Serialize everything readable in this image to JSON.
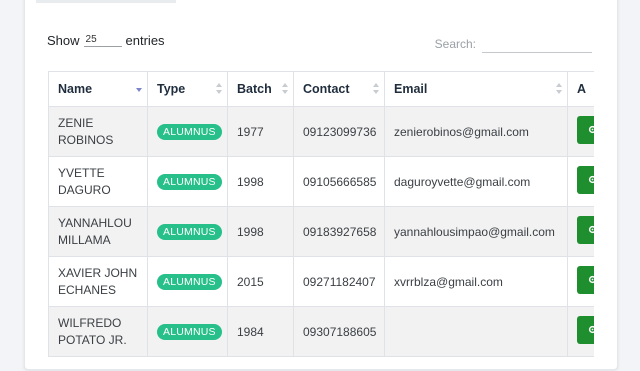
{
  "length": {
    "prefix": "Show",
    "value": "25",
    "suffix": "entries"
  },
  "search": {
    "label": "Search:",
    "value": ""
  },
  "table": {
    "columns": [
      "Name",
      "Type",
      "Batch",
      "Contact",
      "Email",
      "A"
    ],
    "rows": [
      {
        "name_line1": "ZENIE",
        "name_line2": "ROBINOS",
        "type": "ALUMNUS",
        "batch": "1977",
        "contact": "09123099736",
        "email": "zenierobinos@gmail.com"
      },
      {
        "name_line1": "YVETTE",
        "name_line2": "DAGURO",
        "type": "ALUMNUS",
        "batch": "1998",
        "contact": "09105666585",
        "email": "daguroyvette@gmail.com"
      },
      {
        "name_line1": "YANNAHLOU",
        "name_line2": "MILLAMA",
        "type": "ALUMNUS",
        "batch": "1998",
        "contact": "09183927658",
        "email": "yannahlousimpao@gmail.com"
      },
      {
        "name_line1": "XAVIER JOHN",
        "name_line2": "ECHANES",
        "type": "ALUMNUS",
        "batch": "2015",
        "contact": "09271182407",
        "email": "xvrrblza@gmail.com"
      },
      {
        "name_line1": "WILFREDO",
        "name_line2": "POTATO JR.",
        "type": "ALUMNUS",
        "batch": "1984",
        "contact": "09307188605",
        "email": ""
      }
    ]
  },
  "colors": {
    "badge": "#28c08a",
    "action_button": "#1e8e2f",
    "sort_active": "#7a86c9"
  },
  "icons": {
    "action": "gear-icon"
  }
}
